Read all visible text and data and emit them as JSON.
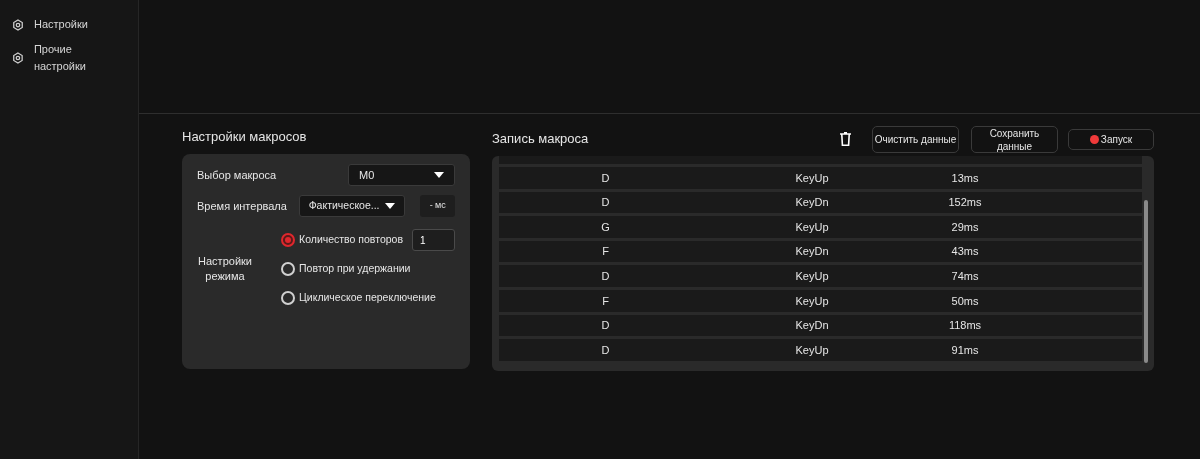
{
  "sidebar": {
    "items": [
      {
        "label": "Настройки",
        "selected": false
      },
      {
        "label": "Прочие настройки",
        "selected": false
      }
    ]
  },
  "macro_settings": {
    "title": "Настройки макросов",
    "macro_select": {
      "label": "Выбор макроса",
      "value": "M0"
    },
    "interval": {
      "label": "Время интервала",
      "value": "Фактическое...",
      "unit": "- мс"
    },
    "mode": {
      "label": "Настройки режима",
      "options": [
        {
          "label": "Количество повторов",
          "selected": true,
          "count": "1"
        },
        {
          "label": "Повтор при удержании",
          "selected": false
        },
        {
          "label": "Циклическое переключение",
          "selected": false
        }
      ]
    }
  },
  "macro_record": {
    "title": "Запись макроса",
    "buttons": [
      {
        "kind": "clear",
        "label": "Очистить данные"
      },
      {
        "kind": "save",
        "label": "Сохранить данные"
      },
      {
        "kind": "run",
        "label": "Запуск"
      }
    ],
    "rows": [
      {
        "key": "D",
        "action": "KeyUp",
        "delay": "13ms"
      },
      {
        "key": "D",
        "action": "KeyDn",
        "delay": "152ms"
      },
      {
        "key": "G",
        "action": "KeyUp",
        "delay": "29ms"
      },
      {
        "key": "F",
        "action": "KeyDn",
        "delay": "43ms"
      },
      {
        "key": "D",
        "action": "KeyUp",
        "delay": "74ms"
      },
      {
        "key": "F",
        "action": "KeyUp",
        "delay": "50ms"
      },
      {
        "key": "D",
        "action": "KeyDn",
        "delay": "118ms"
      },
      {
        "key": "D",
        "action": "KeyUp",
        "delay": "91ms"
      }
    ]
  }
}
